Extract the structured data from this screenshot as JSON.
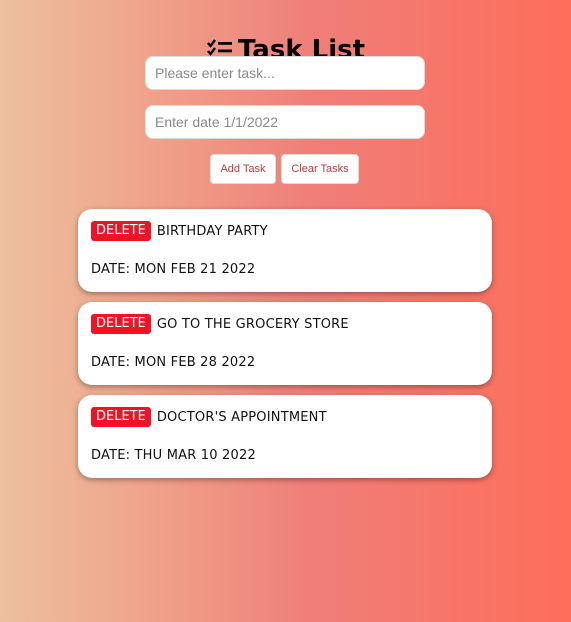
{
  "header": {
    "title": "Task List",
    "icon": "checklist-icon"
  },
  "form": {
    "task_placeholder": "Please enter task...",
    "date_placeholder": "Enter date 1/1/2022",
    "add_label": "Add Task",
    "clear_label": "Clear Tasks"
  },
  "tasks": [
    {
      "delete_label": "DELETE",
      "name": "BIRTHDAY PARTY",
      "date": "DATE: MON FEB 21 2022"
    },
    {
      "delete_label": "DELETE",
      "name": "GO TO THE GROCERY STORE",
      "date": "DATE: MON FEB 28 2022"
    },
    {
      "delete_label": "DELETE",
      "name": "DOCTOR'S APPOINTMENT",
      "date": "DATE: THU MAR 10 2022"
    }
  ],
  "colors": {
    "delete": "#ee1325",
    "button_text": "#c0393b"
  }
}
